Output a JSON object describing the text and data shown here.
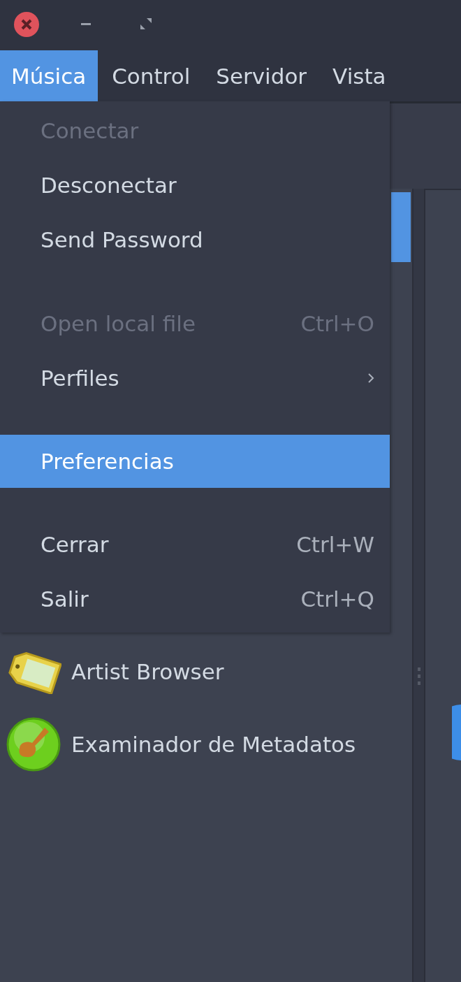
{
  "window": {
    "controls": [
      {
        "kind": "close"
      },
      {
        "kind": "minimize"
      },
      {
        "kind": "maximize"
      }
    ]
  },
  "menubar": [
    {
      "label": "Música",
      "selected": true
    },
    {
      "label": "Control",
      "selected": false
    },
    {
      "label": "Servidor",
      "selected": false
    },
    {
      "label": "Vista",
      "selected": false
    }
  ],
  "menu": [
    {
      "kind": "item",
      "label": "Conectar",
      "disabled": true,
      "selected": false
    },
    {
      "kind": "item",
      "label": "Desconectar",
      "disabled": false,
      "selected": false
    },
    {
      "kind": "item",
      "label": "Send Password",
      "disabled": false,
      "selected": false
    },
    {
      "kind": "separator"
    },
    {
      "kind": "item",
      "label": "Open local file",
      "shortcut": "Ctrl+O",
      "disabled": true,
      "selected": false
    },
    {
      "kind": "submenu",
      "label": "Perfiles",
      "disabled": false,
      "selected": false
    },
    {
      "kind": "separator"
    },
    {
      "kind": "item",
      "label": "Preferencias",
      "disabled": false,
      "selected": true
    },
    {
      "kind": "separator"
    },
    {
      "kind": "item",
      "label": "Cerrar",
      "shortcut": "Ctrl+W",
      "disabled": false,
      "selected": false
    },
    {
      "kind": "item",
      "label": "Salir",
      "shortcut": "Ctrl+Q",
      "disabled": false,
      "selected": false
    }
  ],
  "sidebar": {
    "items": [
      {
        "label": "Artist Browser"
      },
      {
        "label": "Examinador de Metadatos"
      }
    ]
  }
}
